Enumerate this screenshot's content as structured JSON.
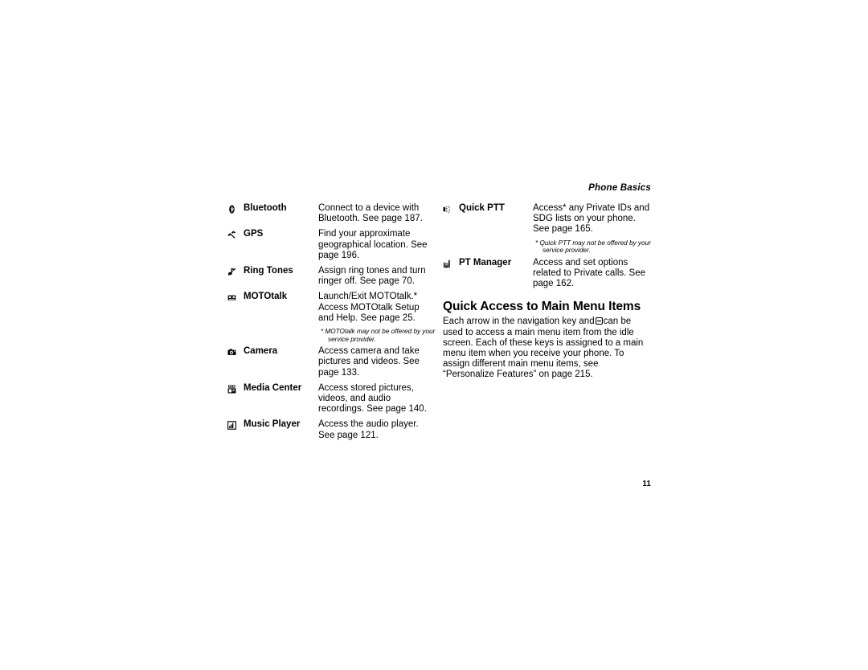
{
  "header": {
    "running_head": "Phone Basics"
  },
  "folio": {
    "page_number": "11"
  },
  "left_column": {
    "entries": [
      {
        "icon": "bluetooth-icon",
        "term": "Bluetooth",
        "definition": "Connect to a device with Bluetooth. See page 187."
      },
      {
        "icon": "gps-satellite-icon",
        "term": "GPS",
        "definition": "Find your approximate geographical location. See page 196."
      },
      {
        "icon": "ring-tones-icon",
        "term": "Ring Tones",
        "definition": "Assign ring tones and turn ringer off. See page 70."
      },
      {
        "icon": "mototalk-icon",
        "term": "MOTOtalk",
        "definition": "Launch/Exit MOTOtalk.* Access MOTOtalk Setup and Help. See page 25.",
        "footnote": "MOTOtalk may not be offered by your service provider."
      },
      {
        "icon": "camera-icon",
        "term": "Camera",
        "definition": "Access camera and take pictures and videos. See page 133."
      },
      {
        "icon": "media-center-icon",
        "term": "Media Center",
        "definition": "Access stored pictures, videos, and audio recordings. See page 140."
      },
      {
        "icon": "music-player-icon",
        "term": "Music Player",
        "definition": "Access the audio player. See page 121."
      }
    ]
  },
  "right_column": {
    "entries": [
      {
        "icon": "quick-ptt-icon",
        "term": "Quick PTT",
        "definition": "Access* any Private IDs and SDG lists on your phone. See page 165.",
        "footnote": "Quick PTT may not be offered by your service provider."
      },
      {
        "icon": "pt-manager-icon",
        "term": "PT Manager",
        "definition": "Access and set options related to Private calls. See page 162."
      }
    ],
    "section": {
      "heading": "Quick Access to Main Menu Items",
      "body_before_icon": "Each arrow in the navigation key and",
      "inline_icon": "menu-key-icon",
      "body_after_icon": "can be used to access a main menu item from the idle screen. Each of these keys is assigned to a main menu item when you receive your phone. To assign different main menu items, see “Personalize Features” on page 215."
    }
  },
  "footnote_marker": "*",
  "colors": {
    "text": "#000000",
    "background": "#ffffff"
  }
}
